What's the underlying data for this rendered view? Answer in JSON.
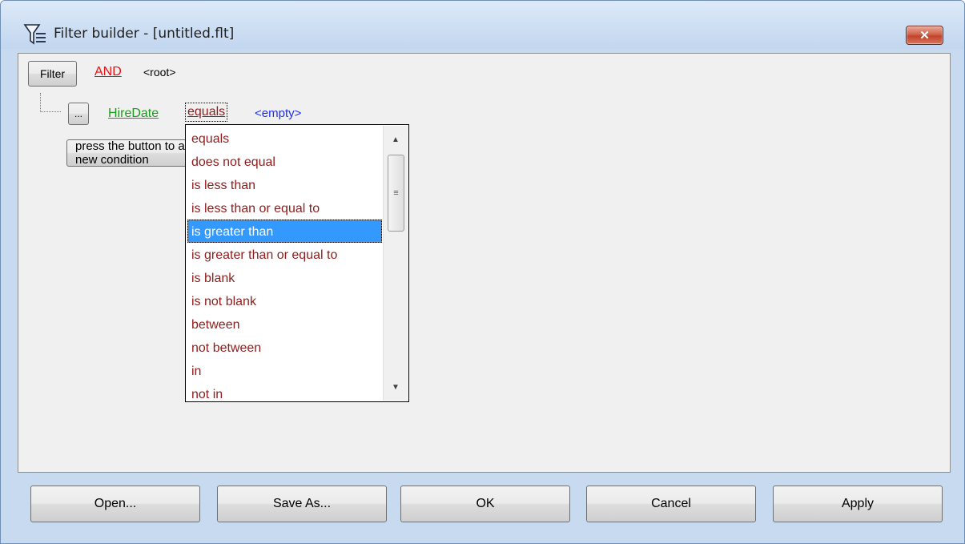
{
  "window": {
    "title": "Filter builder - [untitled.flt]",
    "title_icon": "filter-funnel-icon",
    "close_label": "✕"
  },
  "filter": {
    "filter_button": "Filter",
    "root_operator": "AND",
    "root_label": "<root>",
    "condition": {
      "options_button": "...",
      "field": "HireDate",
      "operator": "equals",
      "value": "<empty>"
    },
    "press_button": "press the button to add a new condition"
  },
  "operator_dropdown": {
    "selected": "is greater than",
    "options": [
      "equals",
      "does not equal",
      "is less than",
      "is less than or equal to",
      "is greater than",
      "is greater than or equal to",
      "is blank",
      "is not blank",
      "between",
      "not between",
      "in",
      "not in"
    ]
  },
  "buttons": {
    "open": "Open...",
    "save_as": "Save As...",
    "ok": "OK",
    "cancel": "Cancel",
    "apply": "Apply"
  },
  "colors": {
    "and_operator": "#ee1111",
    "field": "#1e9b1e",
    "operator": "#8f1c1c",
    "value": "#1e2ef0",
    "selection": "#3399ff"
  }
}
